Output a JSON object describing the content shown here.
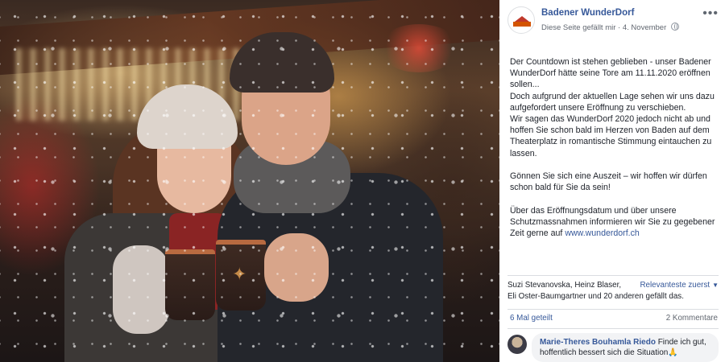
{
  "post": {
    "page_name": "Badener WunderDorf",
    "like_page": "Diese Seite gefällt mir",
    "separator": " · ",
    "date": "4. November",
    "paragraphs": [
      [
        "Der Countdown ist stehen geblieben - unser Badener WunderDorf hätte seine Tore am 11.11.2020 eröffnen sollen...",
        "Doch aufgrund der aktuellen Lage sehen wir uns dazu aufgefordert unsere Eröffnung zu verschieben.",
        "Wir sagen das WunderDorf 2020 jedoch nicht ab und hoffen Sie schon bald im Herzen von Baden auf dem Theaterplatz in romantische Stimmung eintauchen zu lassen."
      ],
      [
        "Gönnen Sie sich eine Auszeit – wir hoffen wir dürfen schon bald für Sie da sein!"
      ],
      [
        "Über das Eröffnungsdatum und über unsere Schutzmassnahmen informieren wir Sie zu gegebener Zeit gerne auf"
      ]
    ],
    "link": "www.wunderdorf.ch",
    "reactions_line1": "Suzi Stevanovska, Heinz Blaser,",
    "reactions_line2": "Eli Oster-Baumgartner und 20 anderen gefällt das.",
    "sort_label": "Relevanteste zuerst",
    "shares": "6 Mal geteilt",
    "comments_count": "2 Kommentare",
    "comment": {
      "author": "Marie-Theres Bouhamla Riedo",
      "text": "Finde ich gut, hoffentlich bessert sich die Situation🙏"
    }
  },
  "icons": {
    "page_avatar": "wunderdorf-logo-icon",
    "privacy": "globe-icon",
    "more": "more-options-icon",
    "sort": "caret-down-icon"
  },
  "colors": {
    "link": "#365899",
    "text": "#1d2129",
    "meta": "#616770",
    "comment_bubble": "#f2f3f5"
  }
}
